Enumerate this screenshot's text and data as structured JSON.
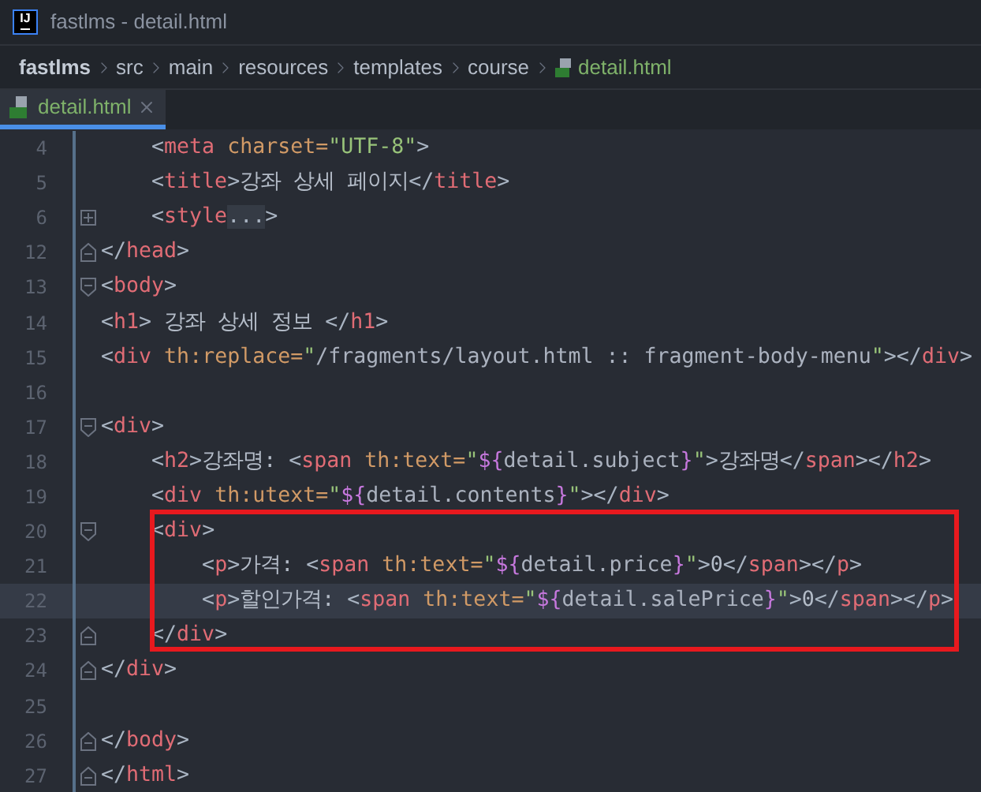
{
  "window": {
    "logo": "IJ",
    "title": "fastlms - detail.html"
  },
  "breadcrumb": [
    {
      "label": "fastlms",
      "kind": "project"
    },
    {
      "label": "src",
      "kind": "folder"
    },
    {
      "label": "main",
      "kind": "folder"
    },
    {
      "label": "resources",
      "kind": "folder"
    },
    {
      "label": "templates",
      "kind": "folder"
    },
    {
      "label": "course",
      "kind": "folder"
    },
    {
      "label": "detail.html",
      "kind": "file"
    }
  ],
  "tabs": [
    {
      "label": "detail.html",
      "selected": true
    }
  ],
  "editor": {
    "lines": [
      {
        "number": "4",
        "kind": "plain",
        "current": false,
        "tokens": [
          {
            "kind": "punct",
            "text": "    <"
          },
          {
            "kind": "tag",
            "text": "meta"
          },
          {
            "kind": "attr",
            "text": " charset="
          },
          {
            "kind": "string",
            "text": "\"UTF-8\""
          },
          {
            "kind": "punct",
            "text": ">"
          }
        ]
      },
      {
        "number": "5",
        "kind": "plain",
        "current": false,
        "tokens": [
          {
            "kind": "punct",
            "text": "    <"
          },
          {
            "kind": "tag",
            "text": "title"
          },
          {
            "kind": "punct",
            "text": ">"
          },
          {
            "kind": "text",
            "text": "강좌 상세 페이지"
          },
          {
            "kind": "punct",
            "text": "</"
          },
          {
            "kind": "tag",
            "text": "title"
          },
          {
            "kind": "punct",
            "text": ">"
          }
        ]
      },
      {
        "number": "6",
        "kind": "folded",
        "current": false,
        "tokens": [
          {
            "kind": "punct",
            "text": "    <"
          },
          {
            "kind": "tag",
            "text": "style"
          },
          {
            "kind": "folded",
            "text": "..."
          },
          {
            "kind": "punct",
            "text": ">"
          }
        ]
      },
      {
        "number": "12",
        "kind": "fold-end",
        "current": false,
        "tokens": [
          {
            "kind": "punct",
            "text": "</"
          },
          {
            "kind": "tag",
            "text": "head"
          },
          {
            "kind": "punct",
            "text": ">"
          }
        ]
      },
      {
        "number": "13",
        "kind": "fold-start",
        "current": false,
        "tokens": [
          {
            "kind": "punct",
            "text": "<"
          },
          {
            "kind": "tag",
            "text": "body"
          },
          {
            "kind": "punct",
            "text": ">"
          }
        ]
      },
      {
        "number": "14",
        "kind": "plain",
        "current": false,
        "tokens": [
          {
            "kind": "punct",
            "text": "<"
          },
          {
            "kind": "tag",
            "text": "h1"
          },
          {
            "kind": "punct",
            "text": ">"
          },
          {
            "kind": "text",
            "text": " 강좌 상세 정보 "
          },
          {
            "kind": "punct",
            "text": "</"
          },
          {
            "kind": "tag",
            "text": "h1"
          },
          {
            "kind": "punct",
            "text": ">"
          }
        ]
      },
      {
        "number": "15",
        "kind": "plain",
        "current": false,
        "tokens": [
          {
            "kind": "punct",
            "text": "<"
          },
          {
            "kind": "tag",
            "text": "div"
          },
          {
            "kind": "attr",
            "text": " th:replace="
          },
          {
            "kind": "string",
            "text": "\""
          },
          {
            "kind": "value",
            "text": "/fragments/layout.html :: fragment-body-menu"
          },
          {
            "kind": "string",
            "text": "\""
          },
          {
            "kind": "punct",
            "text": "></"
          },
          {
            "kind": "tag",
            "text": "div"
          },
          {
            "kind": "punct",
            "text": ">"
          }
        ]
      },
      {
        "number": "16",
        "kind": "plain",
        "current": false
      },
      {
        "number": "17",
        "kind": "fold-start",
        "current": false,
        "tokens": [
          {
            "kind": "punct",
            "text": "<"
          },
          {
            "kind": "tag",
            "text": "div"
          },
          {
            "kind": "punct",
            "text": ">"
          }
        ]
      },
      {
        "number": "18",
        "kind": "plain",
        "current": false,
        "tokens": [
          {
            "kind": "punct",
            "text": "    <"
          },
          {
            "kind": "tag",
            "text": "h2"
          },
          {
            "kind": "punct",
            "text": ">"
          },
          {
            "kind": "text",
            "text": "강좌명: "
          },
          {
            "kind": "punct",
            "text": "<"
          },
          {
            "kind": "tag",
            "text": "span"
          },
          {
            "kind": "attr",
            "text": " th:text="
          },
          {
            "kind": "string",
            "text": "\""
          },
          {
            "kind": "expr",
            "text": "${"
          },
          {
            "kind": "value",
            "text": "detail.subject"
          },
          {
            "kind": "expr",
            "text": "}"
          },
          {
            "kind": "string",
            "text": "\""
          },
          {
            "kind": "punct",
            "text": ">"
          },
          {
            "kind": "text",
            "text": "강좌명"
          },
          {
            "kind": "punct",
            "text": "</"
          },
          {
            "kind": "tag",
            "text": "span"
          },
          {
            "kind": "punct",
            "text": "></"
          },
          {
            "kind": "tag",
            "text": "h2"
          },
          {
            "kind": "punct",
            "text": ">"
          }
        ]
      },
      {
        "number": "19",
        "kind": "plain",
        "current": false,
        "tokens": [
          {
            "kind": "punct",
            "text": "    <"
          },
          {
            "kind": "tag",
            "text": "div"
          },
          {
            "kind": "attr",
            "text": " th:utext="
          },
          {
            "kind": "string",
            "text": "\""
          },
          {
            "kind": "expr",
            "text": "${"
          },
          {
            "kind": "value",
            "text": "detail.contents"
          },
          {
            "kind": "expr",
            "text": "}"
          },
          {
            "kind": "string",
            "text": "\""
          },
          {
            "kind": "punct",
            "text": "></"
          },
          {
            "kind": "tag",
            "text": "div"
          },
          {
            "kind": "punct",
            "text": ">"
          }
        ]
      },
      {
        "number": "20",
        "kind": "fold-start",
        "current": false,
        "tokens": [
          {
            "kind": "punct",
            "text": "    <"
          },
          {
            "kind": "tag",
            "text": "div"
          },
          {
            "kind": "punct",
            "text": ">"
          }
        ]
      },
      {
        "number": "21",
        "kind": "plain",
        "current": false,
        "tokens": [
          {
            "kind": "punct",
            "text": "        <"
          },
          {
            "kind": "tag",
            "text": "p"
          },
          {
            "kind": "punct",
            "text": ">"
          },
          {
            "kind": "text",
            "text": "가격: "
          },
          {
            "kind": "punct",
            "text": "<"
          },
          {
            "kind": "tag",
            "text": "span"
          },
          {
            "kind": "attr",
            "text": " th:text="
          },
          {
            "kind": "string",
            "text": "\""
          },
          {
            "kind": "expr",
            "text": "${"
          },
          {
            "kind": "value",
            "text": "detail.price"
          },
          {
            "kind": "expr",
            "text": "}"
          },
          {
            "kind": "string",
            "text": "\""
          },
          {
            "kind": "punct",
            "text": ">"
          },
          {
            "kind": "text",
            "text": "0"
          },
          {
            "kind": "punct",
            "text": "</"
          },
          {
            "kind": "tag",
            "text": "span"
          },
          {
            "kind": "punct",
            "text": "></"
          },
          {
            "kind": "tag",
            "text": "p"
          },
          {
            "kind": "punct",
            "text": ">"
          }
        ]
      },
      {
        "number": "22",
        "kind": "plain",
        "current": true,
        "tokens": [
          {
            "kind": "punct",
            "text": "        <"
          },
          {
            "kind": "tag",
            "text": "p"
          },
          {
            "kind": "punct",
            "text": ">"
          },
          {
            "kind": "text",
            "text": "할인가격: "
          },
          {
            "kind": "punct",
            "text": "<"
          },
          {
            "kind": "tag",
            "text": "span"
          },
          {
            "kind": "attr",
            "text": " th:text="
          },
          {
            "kind": "string",
            "text": "\""
          },
          {
            "kind": "expr",
            "text": "${"
          },
          {
            "kind": "value",
            "text": "detail.salePrice"
          },
          {
            "kind": "expr",
            "text": "}"
          },
          {
            "kind": "string",
            "text": "\""
          },
          {
            "kind": "punct",
            "text": ">"
          },
          {
            "kind": "text",
            "text": "0"
          },
          {
            "kind": "punct",
            "text": "</"
          },
          {
            "kind": "tag",
            "text": "span"
          },
          {
            "kind": "punct",
            "text": "></"
          },
          {
            "kind": "tag",
            "text": "p"
          },
          {
            "kind": "punct",
            "text": ">"
          }
        ]
      },
      {
        "number": "23",
        "kind": "fold-end",
        "current": false,
        "tokens": [
          {
            "kind": "punct",
            "text": "    </"
          },
          {
            "kind": "tag",
            "text": "div"
          },
          {
            "kind": "punct",
            "text": ">"
          }
        ]
      },
      {
        "number": "24",
        "kind": "fold-end",
        "current": false,
        "tokens": [
          {
            "kind": "punct",
            "text": "</"
          },
          {
            "kind": "tag",
            "text": "div"
          },
          {
            "kind": "punct",
            "text": ">"
          }
        ]
      },
      {
        "number": "25",
        "kind": "plain",
        "current": false
      },
      {
        "number": "26",
        "kind": "fold-end",
        "current": false,
        "tokens": [
          {
            "kind": "punct",
            "text": "</"
          },
          {
            "kind": "tag",
            "text": "body"
          },
          {
            "kind": "punct",
            "text": ">"
          }
        ]
      },
      {
        "number": "27",
        "kind": "fold-end",
        "current": false,
        "tokens": [
          {
            "kind": "punct",
            "text": "</"
          },
          {
            "kind": "tag",
            "text": "html"
          },
          {
            "kind": "punct",
            "text": ">"
          }
        ]
      }
    ]
  }
}
